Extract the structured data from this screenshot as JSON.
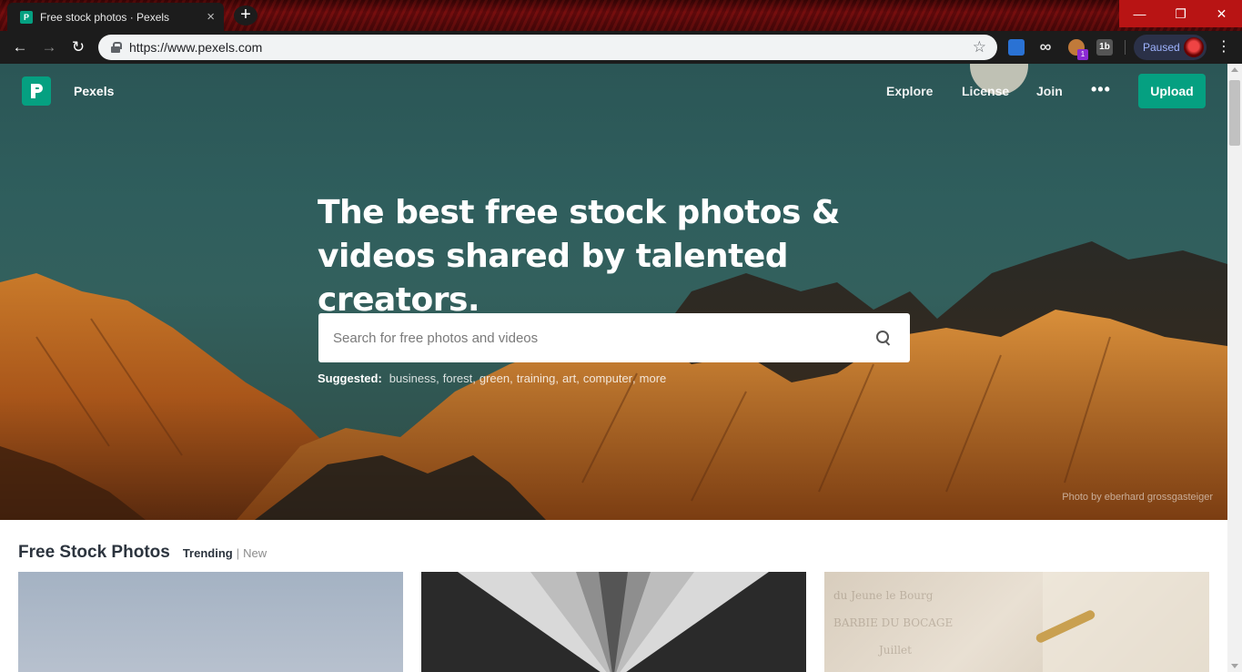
{
  "browser": {
    "tab_title": "Free stock photos · Pexels",
    "url": "https://www.pexels.com",
    "paused_label": "Paused",
    "extension_badge": "1",
    "extension_label": "1b"
  },
  "header": {
    "logo_text": "Pexels",
    "nav": [
      "Explore",
      "License",
      "Join"
    ],
    "more_label": "•••",
    "upload_label": "Upload"
  },
  "hero": {
    "title": "The best free stock photos & videos shared by talented creators.",
    "search_placeholder": "Search for free photos and videos",
    "suggested_label": "Suggested:",
    "suggestions": [
      "business",
      "forest",
      "green",
      "training",
      "art",
      "computer",
      "more"
    ],
    "photo_credit": "Photo by eberhard grossgasteiger"
  },
  "section": {
    "title": "Free Stock Photos",
    "tab_trending": "Trending",
    "tab_separator": "|",
    "tab_new": "New"
  },
  "colors": {
    "brand": "#05a081",
    "hero_sky": "#2f5e5d",
    "mountain": "#b8661c"
  },
  "icons": [
    "back-icon",
    "forward-icon",
    "reload-icon",
    "lock-icon",
    "star-icon",
    "search-icon",
    "menu-icon",
    "close-icon",
    "new-tab-icon"
  ]
}
